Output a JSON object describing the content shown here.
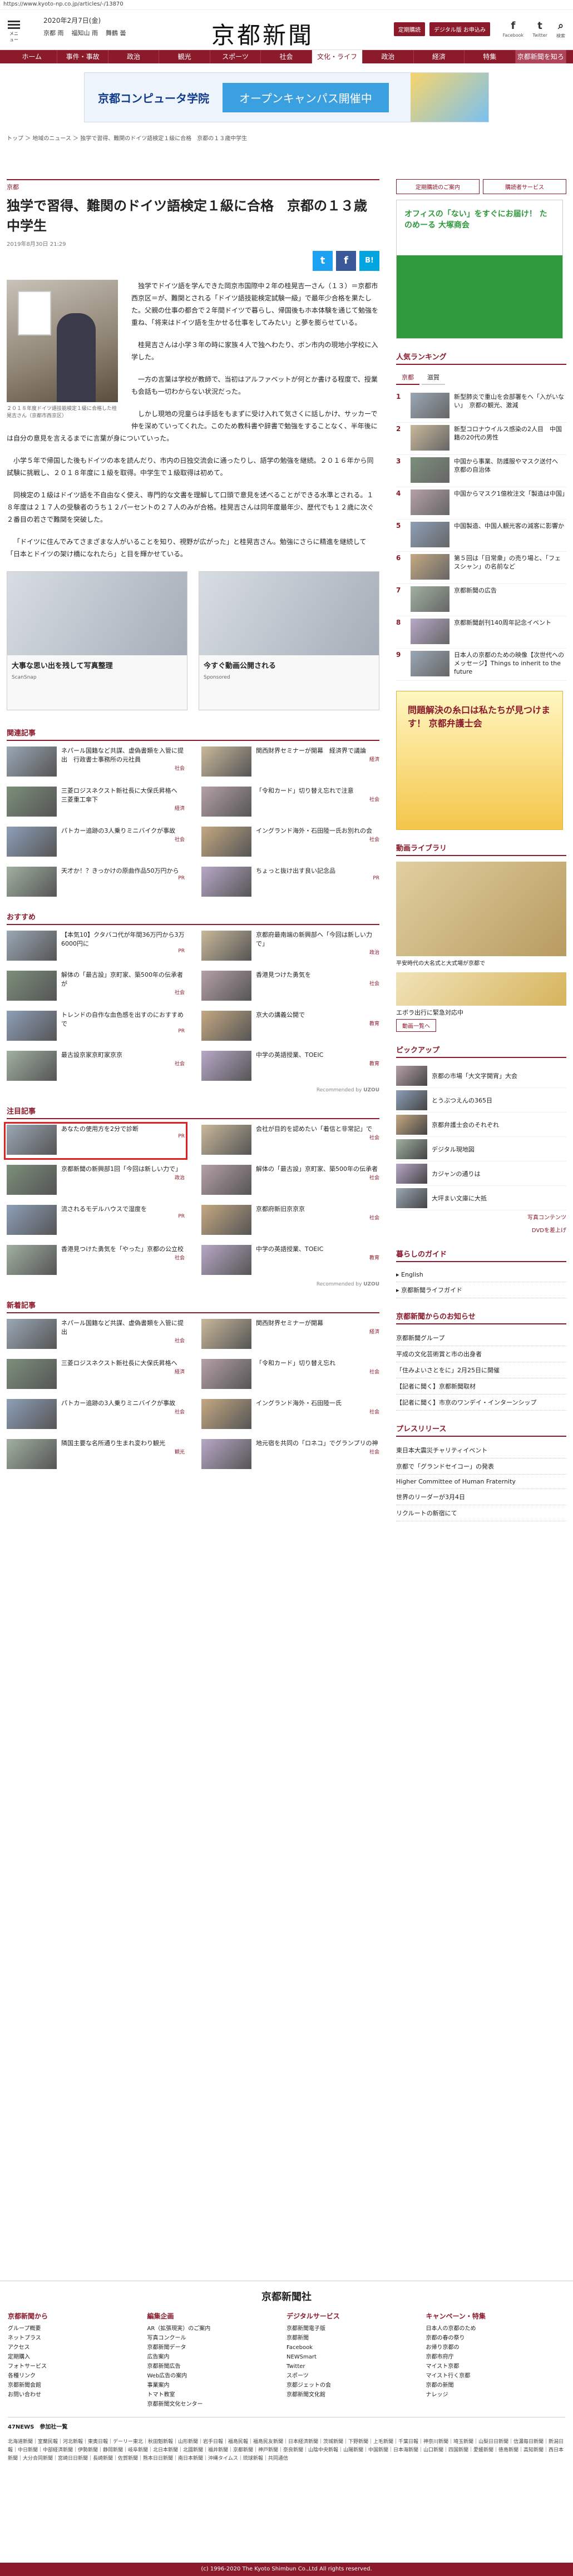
{
  "browser": {
    "url": "https://www.kyoto-np.co.jp/articles/-/13870"
  },
  "header": {
    "menu_label": "メニュー",
    "date": "2020年2月7日(金)",
    "weather": [
      "京都 雨",
      "福知山 雨",
      "舞鶴 曇"
    ],
    "logo": "京都新聞",
    "buttons": [
      "定期購読",
      "デジタル版 お申込み"
    ],
    "social": [
      "Facebook",
      "Twitter",
      "検索"
    ]
  },
  "nav": [
    "ホーム",
    "事件・事故",
    "政治",
    "観光",
    "スポーツ",
    "社会",
    "文化・ライフ",
    "政治",
    "経済",
    "特集",
    "京都新聞を知ろう"
  ],
  "top_ad": {
    "logo": "京都コンピュータ学院",
    "tagline": "オープンキャンパス開催中"
  },
  "breadcrumb": "トップ ＞ 地域のニュース ＞ 独学で習得、難関のドイツ語検定１級に合格　京都の１３歳中学生",
  "article": {
    "category": "京都",
    "title": "独学で習得、難関のドイツ語検定１級に合格　京都の１３歳中学生",
    "date": "2019年8月30日 21:29",
    "photo_caption": "２０１８年度ドイツ語技能検定１級に合格した桂晃吉さん（京都市西京区）",
    "paragraphs": [
      "独学でドイツ語を学んできた岡京市国際中２年の桂晃吉一さん（１３）＝京都市西京区＝が、難関とされる「ドイツ語技能検定試験一級」で最年少合格を果たした。父親の仕事の都合で２年間ドイツで暮らし、帰国後もホ本体験を通じて勉強を重ね、「将来はドイツ語を生かせる仕事をしてみたい」と夢を膨らせている。",
      "桂晃吉さんは小学３年の時に家族４人で独へわたり、ボン市内の現地小学校に入学した。",
      "一方の言葉は学校が教師で、当初はアルファベットが何とか書ける程度で、授業も会話も一切わからない状況だった。",
      "しかし現地の児童らは手話をもまずに受け入れて気さくに話しかけ、サッカーで仲を深めていってくれた。このため教科書や辞書で勉強をすることなく、半年後には自分の意見を言えるまでに言葉が身についていった。",
      "小学５年で帰国した後もドイツの本を読んだり、市内の日独交流会に通ったりし、語学の勉強を継続。２０１６年から同試験に挑戦し、２０１８年度に１級を取得。中学生で１級取得は初めて。",
      "同検定の１級はドイツ語を不自由なく使え、専門的な文書を理解して口頭で意見を述べることができる水準とされる。１８年度は２１７人の受験者のうち１２パーセントの２７人のみが合格。桂晃吉さんは同年度最年少、歴代でも１２歳に次ぐ２番目の若さで難関を突破した。",
      "「ドイツに住んでみてさまざまな人がいることを知り、視野が広がった」と桂晃吉さん。勉強にさらに精進を継続して「日本とドイツの架け橋になれたら」と目を輝かせている。"
    ],
    "share": [
      "t",
      "f",
      "B!"
    ]
  },
  "bottom_ads": [
    {
      "title": "大事な思い出を残して写真整理",
      "sub": "ScanSnap"
    },
    {
      "title": "今すぐ動画公開される",
      "sub": "Sponsored"
    }
  ],
  "related": {
    "title": "関連記事",
    "items": [
      {
        "t": "ネパール国籍など共謀、虚偽書類を入管に提出　行政書士事務所の元社員",
        "tag": "社会"
      },
      {
        "t": "関西財界セミナーが開幕　経済界で議論",
        "tag": "経済"
      },
      {
        "t": "三菱ロジスネクスト新社長に大保氏昇格へ　三菱重工傘下",
        "tag": "経済"
      },
      {
        "t": "「令和カード」切り替え忘れで注意",
        "tag": "社会"
      },
      {
        "t": "パトカー追跡の3人乗りミニバイクが事故",
        "tag": "社会"
      },
      {
        "t": "イングランド海外・石田陸一氏お別れの会",
        "tag": "社会"
      },
      {
        "t": "天才か！？きっかけの原曲作品50万円から",
        "tag": "PR"
      },
      {
        "t": "ちょっと抜け出す良い記念品",
        "tag": "PR"
      }
    ]
  },
  "recommend": {
    "title": "おすすめ",
    "items": [
      {
        "t": "【本気10】クタバコ代が年間36万円から3万6000円に",
        "tag": "PR"
      },
      {
        "t": "京都府最南端の新興部へ「今回は新しい力で」",
        "tag": "政治"
      },
      {
        "t": "解体の「最古設」京町家、築500年の伝承者が",
        "tag": "社会"
      },
      {
        "t": "香港見つけた勇気を",
        "tag": "社会"
      },
      {
        "t": "トレンドの自作な血色感を出すのにおすすめで",
        "tag": "PR"
      },
      {
        "t": "京大の講義公開で",
        "tag": "教育"
      },
      {
        "t": "最古設京家京町家京京",
        "tag": "社会"
      },
      {
        "t": "中学の英語授業、TOEIC",
        "tag": "教育"
      }
    ]
  },
  "attention": {
    "title": "注目記事",
    "items": [
      {
        "t": "あなたの使用方を2分で診断",
        "tag": "PR"
      },
      {
        "t": "会社が目的を認めたい「着信と非常記」で",
        "tag": "社会"
      },
      {
        "t": "京都新聞の新興部1回「今回は新しい力で」",
        "tag": "政治"
      },
      {
        "t": "解体の「最古設」京町家、築500年の伝承者",
        "tag": "社会"
      },
      {
        "t": "流されるモデルハウスで湿度を",
        "tag": "PR"
      },
      {
        "t": "京都府新旧京京京",
        "tag": "社会"
      },
      {
        "t": "香港見つけた勇気を「やった」京都の公立校",
        "tag": "社会"
      },
      {
        "t": "中学の英語授業、TOEIC",
        "tag": "教育"
      }
    ]
  },
  "news": {
    "title": "新着記事",
    "items": [
      {
        "t": "ネパール国籍など共謀、虚偽書類を入管に提出",
        "tag": "社会"
      },
      {
        "t": "関西財界セミナーが開幕",
        "tag": "経済"
      },
      {
        "t": "三菱ロジスネクスト新社長に大保氏昇格へ",
        "tag": "経済"
      },
      {
        "t": "「令和カード」切り替え忘れ",
        "tag": "社会"
      },
      {
        "t": "パトカー追跡の3人乗りミニバイクが事故",
        "tag": "社会"
      },
      {
        "t": "イングランド海外・石田陸一氏",
        "tag": "社会"
      },
      {
        "t": "隣国主要な名所通り生まれ変わり観光",
        "tag": "観光"
      },
      {
        "t": "地元宿を共同の「ロネコ」でグランプリの神",
        "tag": "社会"
      }
    ]
  },
  "sidebar": {
    "buttons": [
      "定期購読のご案内",
      "購読者サービス"
    ],
    "ad1": "オフィスの「ない」をすぐにお届け！ たのめーる 大塚商会",
    "ranking_title": "人気ランキング",
    "ranking_tabs": [
      "京都",
      "滋賀"
    ],
    "ranking": [
      "新型肺炎で重山を会部署をへ「入がいない」　京都の観光、激減",
      "新型コロナウイルス感染の2人目　中国籍の20代の男性",
      "中国から事業、防護服やマスク送付へ　京都の自治体",
      "中国からマスク1億枚注文「製造は中国」",
      "中国製造、中国人観光客の減客に影響か",
      "第５回は「日常衆」の売り場と、「フェスシャン」の名前など",
      "京都新聞の広告",
      "京都新聞創刊140周年記念イベント",
      "日本人の京都のための映像【次世代へのメッセージ】Things to inherit to the future"
    ],
    "ad2": "問題解決の糸口は私たちが見つけます！ 京都弁護士会",
    "video_title": "動画ライブラリ",
    "video_caption": "平安時代の大名式と大式場が京都で",
    "video_sub": "エボラ出行に緊急対応中",
    "video_more": "動画一覧へ",
    "pickup_title": "ピックアップ",
    "pickup": [
      "京都の市場「大文字開宵」大会",
      "とうぶつえんの365日",
      "京都弁護士会のそれぞれ",
      "デジタル現地図",
      "カジャンの通りは",
      "大坪まい文庫に大抵"
    ],
    "pickup_more": "写真コンテンツ",
    "extra": "DVDを差上げ",
    "kurashi_title": "暮らしのガイド",
    "kurashi": [
      "English",
      "京都新聞ライフガイド"
    ],
    "ads3_title": "京都新聞からのお知らせ",
    "ads3": [
      "京都新聞グループ",
      "平成の文化芸術賞と市の出身者",
      "「住みよいさとをに」2月25日に開催",
      "【記者に聞く】京都新聞取材",
      "【記者に聞く】市京のワンデイ・インターンシップ"
    ],
    "press_title": "プレスリリース",
    "press": [
      "東日本大震災チャリティイベント",
      "京都で「グランドセイコー」の発表",
      "Higher Committee of Human Fraternity",
      "世界のリーダーが3月4日",
      "リクルートの新宿にて"
    ]
  },
  "footer": {
    "logo": "京都新聞社",
    "cols": [
      {
        "h": "京都新聞から",
        "items": [
          "グループ概要",
          "ネットプラス",
          "アクセス",
          "定期購入",
          "フォトサービス",
          "各種リンク",
          "京都新聞会館",
          "お問い合わせ"
        ]
      },
      {
        "h": "編集企画",
        "items": [
          "AR（拡張現実）のご案内",
          "写真コンクール",
          "京都新聞データ",
          "広告案内",
          "京都新聞広告",
          "Web広告の案内",
          "事業案内",
          "トマト教室",
          "京都新聞文化センター"
        ]
      },
      {
        "h": "デジタルサービス",
        "items": [
          "京都新聞電子版",
          "京都新聞",
          "Facebook",
          "NEWSmart",
          "Twitter",
          "スポーツ",
          "京都ジェットの会",
          "京都新聞文化館"
        ]
      },
      {
        "h": "キャンペーン・特集",
        "items": [
          "日本人の京都のため",
          "京都の春の祭り",
          "お帰り京都の",
          "京都市府庁",
          "マイスト京都",
          "マイスト行く京都",
          "京都の新聞",
          "ナレッジ"
        ]
      }
    ],
    "fournews": "47NEWS　参加社一覧",
    "fournews_list": "北海道新聞｜室蘭民報｜河北新報｜東奥日報｜デーリー東北｜秋田魁新報｜山形新聞｜岩手日報｜福島民報｜福島民友新聞｜日本経済新聞｜茨城新聞｜下野新聞｜上毛新聞｜千葉日報｜神奈川新聞｜埼玉新聞｜山梨日日新聞｜信濃毎日新聞｜新潟日報｜中日新聞｜中部経済新聞｜伊勢新聞｜静岡新聞｜岐阜新聞｜北日本新聞｜北國新聞｜福井新聞｜京都新聞｜神戸新聞｜奈良新聞｜山陰中央新報｜山陽新聞｜中国新聞｜日本海新聞｜山口新聞｜四国新聞｜愛媛新聞｜徳島新聞｜高知新聞｜西日本新聞｜大分合同新聞｜宮崎日日新聞｜長崎新聞｜佐賀新聞｜熊本日日新聞｜南日本新聞｜沖縄タイムス｜琉球新報｜共同通信",
    "copyright": "(c) 1996-2020 The Kyoto Shimbun Co.,Ltd All rights reserved."
  },
  "colors": {
    "brand": "#8b1a2b",
    "highlight": "#e02020"
  }
}
